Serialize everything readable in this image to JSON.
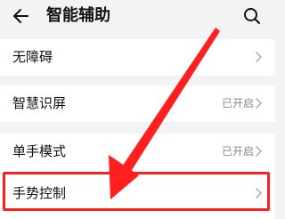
{
  "header": {
    "title": "智能辅助"
  },
  "list": {
    "items": [
      {
        "label": "无障碍",
        "status": ""
      },
      {
        "label": "智慧识屏",
        "status": "已开启"
      },
      {
        "label": "单手模式",
        "status": "已开启"
      },
      {
        "label": "手势控制",
        "status": ""
      }
    ]
  },
  "icons": {
    "back": "back-arrow-icon",
    "search": "search-icon",
    "chevron": "chevron-right-icon"
  },
  "colors": {
    "background": "#f1f3f5",
    "annotation": "#ff1f1f"
  }
}
